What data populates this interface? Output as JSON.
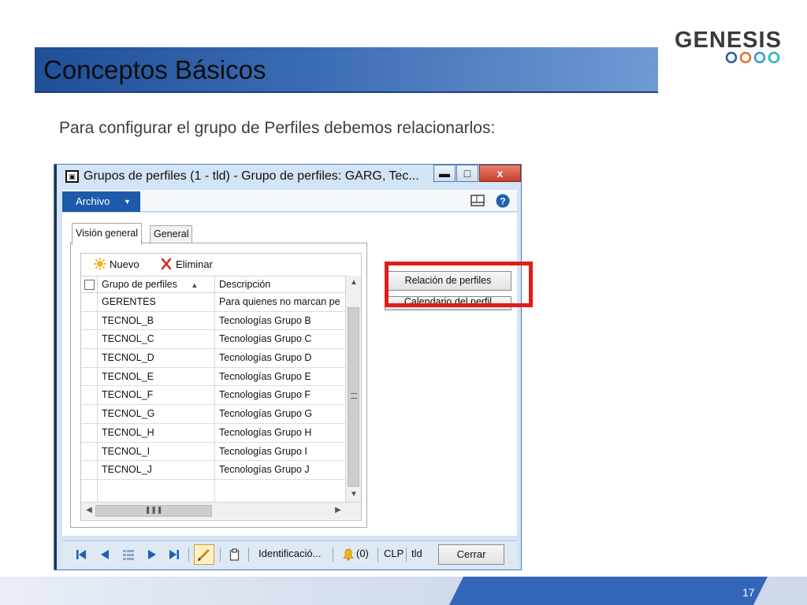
{
  "slide": {
    "title": "Conceptos Básicos",
    "subtitle": "Para configurar el grupo de Perfiles debemos relacionarlos:",
    "logo_text": "GENESIS",
    "page_number": "17",
    "colors": {
      "title_bar": "#2f5fa6",
      "footer": "#3366b8",
      "highlight": "#e21b1b"
    }
  },
  "window": {
    "title": "Grupos de perfiles (1 - tld) - Grupo de perfiles: GARG, Tec...",
    "controls": {
      "minimize": "▬",
      "maximize": "□",
      "close": "x"
    },
    "menu": {
      "archivo": "Archivo"
    },
    "tabs": [
      {
        "label": "Visión general"
      },
      {
        "label": "General"
      }
    ],
    "toolbar": {
      "new_label": "Nuevo",
      "delete_label": "Eliminar"
    },
    "grid": {
      "headers": {
        "group": "Grupo de perfiles",
        "description": "Descripción"
      },
      "rows": [
        {
          "group": "GERENTES",
          "description": "Para quienes no marcan pe"
        },
        {
          "group": "TECNOL_B",
          "description": "Tecnologías Grupo B"
        },
        {
          "group": "TECNOL_C",
          "description": "Tecnologías Grupo C"
        },
        {
          "group": "TECNOL_D",
          "description": "Tecnologías Grupo D"
        },
        {
          "group": "TECNOL_E",
          "description": "Tecnologías Grupo E"
        },
        {
          "group": "TECNOL_F",
          "description": "Tecnologías Grupo F"
        },
        {
          "group": "TECNOL_G",
          "description": "Tecnologías Grupo G"
        },
        {
          "group": "TECNOL_H",
          "description": "Tecnologías Grupo H"
        },
        {
          "group": "TECNOL_I",
          "description": "Tecnologías Grupo I"
        },
        {
          "group": "TECNOL_J",
          "description": "Tecnologías Grupo J"
        }
      ]
    },
    "side_buttons": {
      "relacion": "Relación de perfiles",
      "calendario": "Calendario del perfil"
    },
    "status": {
      "identification": "Identificació...",
      "alerts": "(0)",
      "company": "CLP",
      "partition": "tld",
      "close_label": "Cerrar"
    }
  }
}
